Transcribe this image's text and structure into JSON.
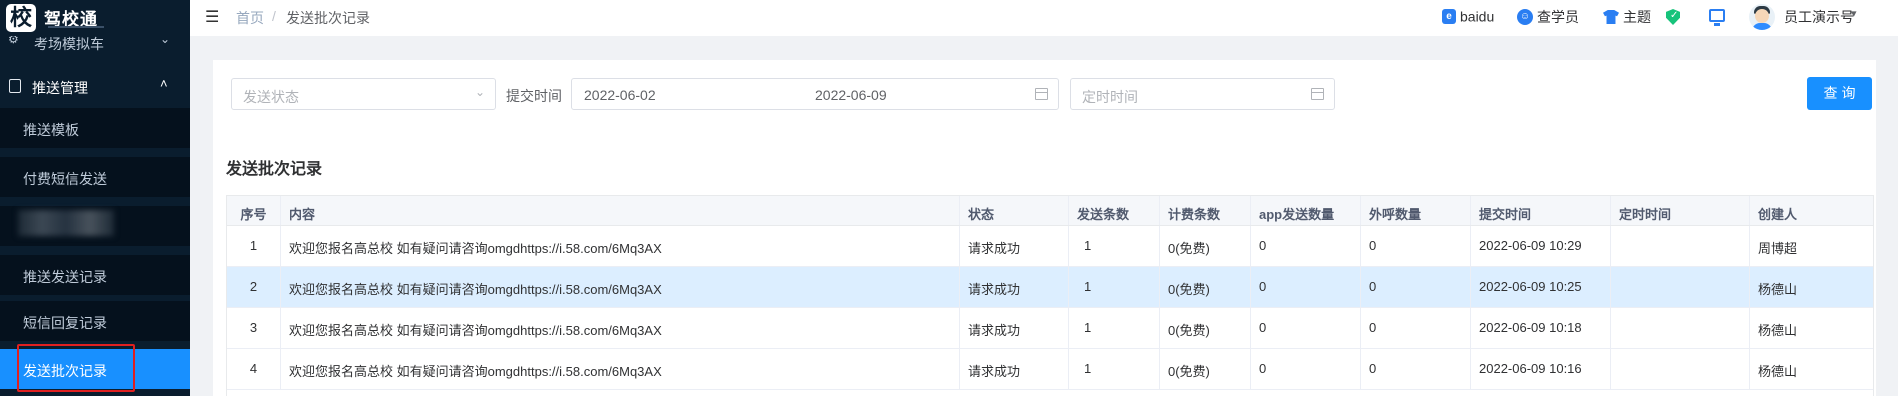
{
  "app": {
    "logo_char": "校",
    "logo_name": "驾校通"
  },
  "sidebar": {
    "clipped_item": "考场模拟车",
    "group_label": "推送管理",
    "items": [
      {
        "label": "推送模板"
      },
      {
        "label": "付费短信发送"
      },
      {
        "label": ""
      },
      {
        "label": "推送发送记录"
      },
      {
        "label": "短信回复记录"
      },
      {
        "label": "发送批次记录",
        "active": true
      }
    ]
  },
  "header": {
    "breadcrumb": {
      "home": "首页",
      "separator": "/",
      "current": "发送批次记录"
    },
    "baidu_label": "baidu",
    "search_student_label": "查学员",
    "theme_label": "主题",
    "user_name": "员工演示号"
  },
  "filters": {
    "status_placeholder": "发送状态",
    "submit_time_label": "提交时间",
    "date_start": "2022-06-02",
    "date_arrow": "→",
    "date_end": "2022-06-09",
    "scheduled_placeholder": "定时时间",
    "query_button": "查询"
  },
  "section_title": "发送批次记录",
  "table": {
    "columns": [
      "序号",
      "内容",
      "状态",
      "发送条数",
      "计费条数",
      "app发送数量",
      "外呼数量",
      "提交时间",
      "定时时间",
      "创建人"
    ],
    "rows": [
      {
        "no": "1",
        "content": "欢迎您报名高总校 如有疑问请咨询omgdhttps://i.58.com/6Mq3AX",
        "status": "请求成功",
        "sent": "1",
        "billed": "0(免费)",
        "app": "0",
        "call": "0",
        "submit_time": "2022-06-09 10:29",
        "scheduled": "",
        "creator": "周博超"
      },
      {
        "no": "2",
        "content": "欢迎您报名高总校 如有疑问请咨询omgdhttps://i.58.com/6Mq3AX",
        "status": "请求成功",
        "sent": "1",
        "billed": "0(免费)",
        "app": "0",
        "call": "0",
        "submit_time": "2022-06-09 10:25",
        "scheduled": "",
        "creator": "杨德山"
      },
      {
        "no": "3",
        "content": "欢迎您报名高总校 如有疑问请咨询omgdhttps://i.58.com/6Mq3AX",
        "status": "请求成功",
        "sent": "1",
        "billed": "0(免费)",
        "app": "0",
        "call": "0",
        "submit_time": "2022-06-09 10:18",
        "scheduled": "",
        "creator": "杨德山"
      },
      {
        "no": "4",
        "content": "欢迎您报名高总校 如有疑问请咨询omgdhttps://i.58.com/6Mq3AX",
        "status": "请求成功",
        "sent": "1",
        "billed": "0(免费)",
        "app": "0",
        "call": "0",
        "submit_time": "2022-06-09 10:16",
        "scheduled": "",
        "creator": "杨德山"
      }
    ]
  },
  "colors": {
    "sidebar_bg": "#0a1d2e",
    "accent": "#1890ff",
    "row_highlight": "#dceeff",
    "annotation_box": "#e02020"
  },
  "icons": [
    "menu-toggle-icon",
    "baidu-icon",
    "search-student-icon",
    "theme-shirt-icon",
    "shield-check-icon",
    "monitor-icon",
    "user-avatar",
    "calendar-icon",
    "chevron-down-icon",
    "chevron-up-icon"
  ]
}
